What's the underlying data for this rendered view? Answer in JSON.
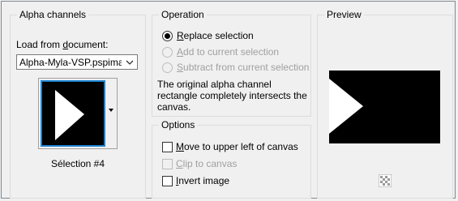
{
  "alpha_channels": {
    "title": "Alpha channels",
    "load_label_pre": "Load from ",
    "load_label_u": "d",
    "load_label_post": "ocument:",
    "document_value": "Alpha-Myla-VSP.pspimage",
    "selection_caption": "Sélection #4"
  },
  "operation": {
    "title": "Operation",
    "options": [
      {
        "underline": "R",
        "rest": "eplace selection",
        "selected": true,
        "enabled": true
      },
      {
        "underline": "A",
        "rest": "dd to current selection",
        "selected": false,
        "enabled": false
      },
      {
        "underline": "S",
        "rest": "ubtract from current selection",
        "selected": false,
        "enabled": false
      }
    ],
    "description_lines": [
      "The original alpha channel",
      "rectangle completely intersects the",
      "canvas."
    ]
  },
  "options": {
    "title": "Options",
    "items": [
      {
        "underline": "M",
        "rest": "ove to upper left of canvas",
        "checked": false,
        "enabled": true
      },
      {
        "underline": "C",
        "rest": "lip to canvas",
        "checked": false,
        "enabled": false
      },
      {
        "underline": "I",
        "rest": "nvert image",
        "checked": false,
        "enabled": true
      }
    ]
  },
  "preview": {
    "title": "Preview"
  }
}
